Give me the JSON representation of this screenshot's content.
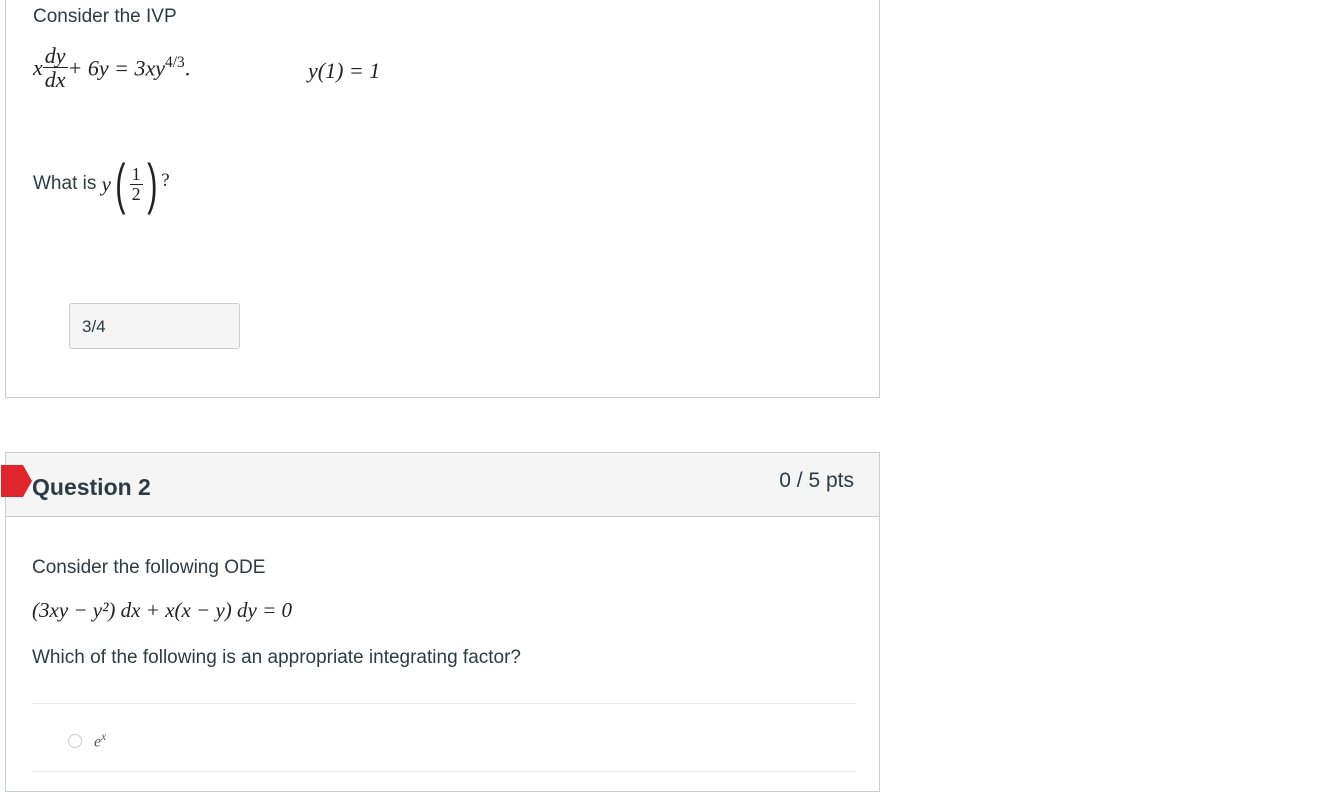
{
  "question1": {
    "intro": "Consider the IVP",
    "equation": {
      "lhs_prefix": "x",
      "deriv_num": "dy",
      "deriv_den": "dx",
      "plus_term": " + 6y = 3xy",
      "exponent": "4/3",
      "end": "."
    },
    "initial_condition": "y(1) = 1",
    "prompt_prefix": "What is ",
    "prompt_var": "y",
    "prompt_frac_num": "1",
    "prompt_frac_den": "2",
    "prompt_suffix": "?",
    "answer": "3/4"
  },
  "question2": {
    "title": "Question 2",
    "points": "0 / 5 pts",
    "intro": "Consider the following ODE",
    "ode": "(3xy − y²) dx + x(x − y) dy = 0",
    "prompt": "Which of the following is an appropriate integrating factor?",
    "options": [
      {
        "base": "e",
        "exp": "x"
      }
    ],
    "flag_color": "#e0252c"
  }
}
